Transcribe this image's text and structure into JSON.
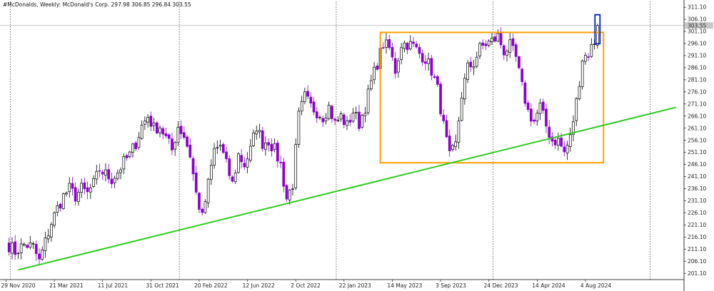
{
  "header": {
    "symbol": "#McDonalds",
    "timeframe": "Weekly",
    "description": "McDonald's Corp.",
    "ohlc": "297.98 306.85 296.84 303.55"
  },
  "chart_data": {
    "type": "candlestick",
    "title": "",
    "xlabel": "",
    "ylabel": "",
    "ylim": [
      198.5,
      313.5
    ],
    "y_ticks": [
      311.1,
      306.1,
      301.1,
      296.1,
      291.1,
      286.1,
      281.1,
      276.1,
      271.1,
      266.1,
      261.1,
      256.1,
      251.1,
      246.1,
      241.1,
      236.1,
      231.1,
      226.1,
      221.1,
      216.1,
      211.1,
      206.1,
      201.1
    ],
    "x_tick_labels": [
      "29 Nov 2020",
      "21 Mar 2021",
      "11 Jul 2021",
      "31 Oct 2021",
      "20 Feb 2022",
      "12 Jun 2022",
      "2 Oct 2022",
      "22 Jan 2023",
      "14 May 2023",
      "3 Sep 2023",
      "24 Dec 2023",
      "14 Apr 2024",
      "4 Aug 2024"
    ],
    "x_tick_weeks": [
      0,
      16,
      32,
      48,
      64,
      80,
      96,
      112,
      128,
      144,
      160,
      176,
      192
    ],
    "current_price": 303.55,
    "colors": {
      "bull": "#000000",
      "bear": "#8b00d0",
      "box": "#ffa000",
      "trendline": "#2ecc20",
      "highlight": "#0022cc",
      "grid": "#333333"
    },
    "close_path": [
      [
        0,
        214
      ],
      [
        3,
        210
      ],
      [
        6,
        213
      ],
      [
        9,
        212
      ],
      [
        11,
        206
      ],
      [
        13,
        214
      ],
      [
        15,
        222
      ],
      [
        17,
        228
      ],
      [
        19,
        233
      ],
      [
        21,
        236
      ],
      [
        23,
        233
      ],
      [
        25,
        236
      ],
      [
        27,
        234
      ],
      [
        29,
        238
      ],
      [
        31,
        244
      ],
      [
        33,
        242
      ],
      [
        35,
        240
      ],
      [
        37,
        243
      ],
      [
        39,
        247
      ],
      [
        41,
        250
      ],
      [
        43,
        255
      ],
      [
        45,
        262
      ],
      [
        47,
        266
      ],
      [
        49,
        261
      ],
      [
        51,
        262
      ],
      [
        53,
        257
      ],
      [
        55,
        252
      ],
      [
        57,
        262
      ],
      [
        59,
        258
      ],
      [
        61,
        250
      ],
      [
        63,
        234
      ],
      [
        65,
        224
      ],
      [
        67,
        238
      ],
      [
        69,
        252
      ],
      [
        71,
        254
      ],
      [
        73,
        246
      ],
      [
        75,
        238
      ],
      [
        77,
        250
      ],
      [
        79,
        246
      ],
      [
        81,
        252
      ],
      [
        83,
        262
      ],
      [
        85,
        255
      ],
      [
        87,
        256
      ],
      [
        89,
        252
      ],
      [
        91,
        246
      ],
      [
        93,
        232
      ],
      [
        95,
        238
      ],
      [
        97,
        266
      ],
      [
        99,
        274
      ],
      [
        101,
        270
      ],
      [
        103,
        268
      ],
      [
        105,
        266
      ],
      [
        107,
        270
      ],
      [
        109,
        263
      ],
      [
        111,
        266
      ],
      [
        113,
        262
      ],
      [
        115,
        268
      ],
      [
        117,
        263
      ],
      [
        119,
        270
      ],
      [
        121,
        280
      ],
      [
        123,
        288
      ],
      [
        125,
        296
      ],
      [
        127,
        294
      ],
      [
        129,
        285
      ],
      [
        131,
        296
      ],
      [
        133,
        296
      ],
      [
        135,
        295
      ],
      [
        137,
        292
      ],
      [
        139,
        290
      ],
      [
        141,
        285
      ],
      [
        143,
        277
      ],
      [
        145,
        262
      ],
      [
        147,
        249
      ],
      [
        149,
        254
      ],
      [
        151,
        275
      ],
      [
        153,
        286
      ],
      [
        155,
        288
      ],
      [
        157,
        294
      ],
      [
        159,
        296
      ],
      [
        161,
        297
      ],
      [
        163,
        299
      ],
      [
        165,
        293
      ],
      [
        167,
        295
      ],
      [
        169,
        290
      ],
      [
        171,
        278
      ],
      [
        173,
        268
      ],
      [
        175,
        264
      ],
      [
        177,
        270
      ],
      [
        179,
        262
      ],
      [
        181,
        256
      ],
      [
        183,
        256
      ],
      [
        185,
        251
      ],
      [
        187,
        257
      ],
      [
        189,
        272
      ],
      [
        191,
        290
      ],
      [
        193,
        292
      ],
      [
        195,
        297
      ],
      [
        196,
        303.55
      ]
    ],
    "range_box": {
      "start_week": 124,
      "end_week": 198,
      "top": 300.7,
      "bottom": 246.8
    },
    "trendline": [
      {
        "week": 4,
        "price": 202.5
      },
      {
        "week": 222,
        "price": 269.7
      }
    ],
    "highlight": {
      "week": 196,
      "low": 296.0,
      "high": 308.0
    }
  }
}
